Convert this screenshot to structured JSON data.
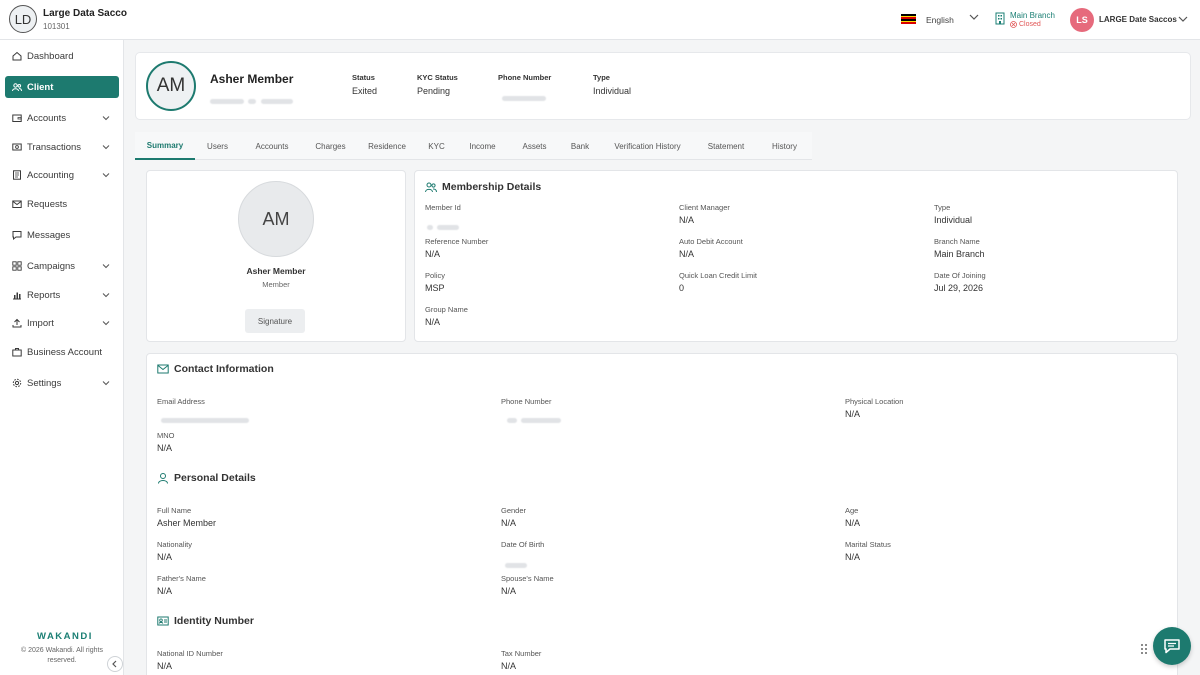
{
  "org": {
    "initials": "LD",
    "name": "Large Data Sacco",
    "code": "101301"
  },
  "topbar": {
    "language": "English",
    "branch_name": "Main Branch",
    "branch_status": "Closed",
    "user_initials": "LS",
    "user_name": "LARGE Date Saccos",
    "flag_colors": [
      "#000000",
      "#fcdc04",
      "#d90000",
      "#000000",
      "#fcdc04",
      "#d90000"
    ]
  },
  "sidebar": {
    "items": [
      {
        "label": "Dashboard",
        "icon": "home-icon",
        "active": false,
        "chevron": false
      },
      {
        "label": "Client",
        "icon": "users-icon",
        "active": true,
        "chevron": false
      },
      {
        "label": "Accounts",
        "icon": "wallet-icon",
        "active": false,
        "chevron": true
      },
      {
        "label": "Transactions",
        "icon": "cash-icon",
        "active": false,
        "chevron": true
      },
      {
        "label": "Accounting",
        "icon": "ledger-icon",
        "active": false,
        "chevron": true
      },
      {
        "label": "Requests",
        "icon": "mail-icon",
        "active": false,
        "chevron": false
      },
      {
        "label": "Messages",
        "icon": "chat-icon",
        "active": false,
        "chevron": false
      },
      {
        "label": "Campaigns",
        "icon": "grid-icon",
        "active": false,
        "chevron": true
      },
      {
        "label": "Reports",
        "icon": "bar-chart-icon",
        "active": false,
        "chevron": true
      },
      {
        "label": "Import",
        "icon": "upload-icon",
        "active": false,
        "chevron": true
      },
      {
        "label": "Business Account",
        "icon": "briefcase-icon",
        "active": false,
        "chevron": false
      },
      {
        "label": "Settings",
        "icon": "gear-icon",
        "active": false,
        "chevron": true
      }
    ],
    "brand": "WAKANDI",
    "copyright": "© 2026 Wakandi. All rights reserved."
  },
  "header": {
    "initials": "AM",
    "name": "Asher Member",
    "status_label": "Status",
    "status_value": "Exited",
    "kyc_label": "KYC Status",
    "kyc_value": "Pending",
    "phone_label": "Phone Number",
    "type_label": "Type",
    "type_value": "Individual"
  },
  "tabs": [
    "Summary",
    "Users",
    "Accounts",
    "Charges",
    "Residence",
    "KYC",
    "Income",
    "Assets",
    "Bank",
    "Verification History",
    "Statement",
    "History"
  ],
  "profile": {
    "initials": "AM",
    "name": "Asher Member",
    "role": "Member",
    "signature_label": "Signature"
  },
  "membership": {
    "title": "Membership Details",
    "member_id_label": "Member Id",
    "client_manager_label": "Client Manager",
    "client_manager_value": "N/A",
    "type_label": "Type",
    "type_value": "Individual",
    "reference_label": "Reference Number",
    "reference_value": "N/A",
    "auto_debit_label": "Auto Debit Account",
    "auto_debit_value": "N/A",
    "branch_label": "Branch Name",
    "branch_value": "Main Branch",
    "policy_label": "Policy",
    "policy_value": "MSP",
    "quick_loan_label": "Quick Loan Credit Limit",
    "quick_loan_value": "0",
    "joining_label": "Date Of Joining",
    "joining_value": "Jul 29, 2026",
    "group_label": "Group Name",
    "group_value": "N/A"
  },
  "contact": {
    "title": "Contact Information",
    "email_label": "Email Address",
    "phone_label": "Phone Number",
    "location_label": "Physical Location",
    "location_value": "N/A",
    "mno_label": "MNO",
    "mno_value": "N/A"
  },
  "personal": {
    "title": "Personal Details",
    "fullname_label": "Full Name",
    "fullname_value": "Asher Member",
    "gender_label": "Gender",
    "gender_value": "N/A",
    "age_label": "Age",
    "age_value": "N/A",
    "nationality_label": "Nationality",
    "nationality_value": "N/A",
    "dob_label": "Date Of Birth",
    "marital_label": "Marital Status",
    "marital_value": "N/A",
    "father_label": "Father's Name",
    "father_value": "N/A",
    "spouse_label": "Spouse's Name",
    "spouse_value": "N/A"
  },
  "identity": {
    "title": "Identity Number",
    "national_id_label": "National ID Number",
    "national_id_value": "N/A",
    "tax_label": "Tax Number",
    "tax_value": "N/A"
  },
  "colors": {
    "accent": "#1d7a6f",
    "closed": "#e15656",
    "user_avatar": "#e66a7c"
  }
}
